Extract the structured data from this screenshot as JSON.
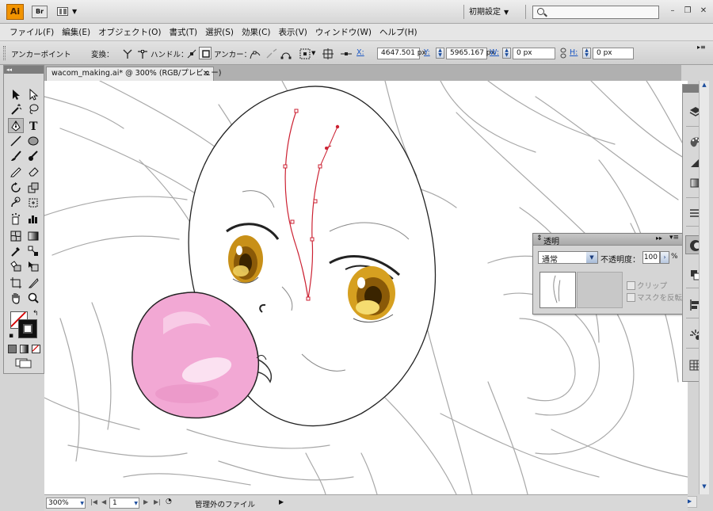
{
  "app": {
    "logo_text": "Ai",
    "bridge_label": "Br"
  },
  "workspace": {
    "label": "初期設定"
  },
  "search": {
    "placeholder": ""
  },
  "menu": [
    "ファイル(F)",
    "編集(E)",
    "オブジェクト(O)",
    "書式(T)",
    "選択(S)",
    "効果(C)",
    "表示(V)",
    "ウィンドウ(W)",
    "ヘルプ(H)"
  ],
  "control": {
    "tool_name": "アンカーポイント",
    "convert_label": "変換：",
    "handle_label": "ハンドル：",
    "anchor_label": "アンカー：",
    "x_label": "X:",
    "x_value": "4647.501 px",
    "y_label": "Y:",
    "y_value": "5965.167 px",
    "w_label": "W:",
    "w_value": "0 px",
    "h_label": "H:",
    "h_value": "0 px"
  },
  "document": {
    "tab_title": "wacom_making.ai* @ 300% (RGB/プレビュー)",
    "close": "×"
  },
  "transparency": {
    "title": "透明",
    "blend_mode": "通常",
    "opacity_label": "不透明度：",
    "opacity_value": "100",
    "opacity_unit": "%",
    "clip_label": "クリップ",
    "invert_mask_label": "マスクを反転"
  },
  "status": {
    "zoom": "300%",
    "page": "1",
    "info": "管理外のファイル"
  },
  "colors": {
    "accent": "#f29400",
    "path_red": "#cc2233",
    "bubble_pink": "#f2a8d4",
    "eye_gold": "#d6a020"
  },
  "icons": [
    "selection-icon",
    "direct-selection-icon",
    "magic-wand-icon",
    "lasso-icon",
    "pen-icon",
    "type-icon",
    "line-icon",
    "ellipse-icon",
    "paintbrush-icon",
    "pencil-icon",
    "blob-brush-icon",
    "eraser-icon",
    "rotate-icon",
    "scale-icon",
    "warp-icon",
    "free-transform-icon",
    "symbol-sprayer-icon",
    "graph-icon",
    "mesh-icon",
    "gradient-icon",
    "eyedropper-icon",
    "blend-icon",
    "live-paint-icon",
    "live-paint-select-icon",
    "artboard-icon",
    "slice-icon",
    "hand-icon",
    "zoom-icon",
    "layers-icon",
    "color-guide-icon",
    "swatches-icon",
    "gradient-panel-icon",
    "stroke-icon",
    "transparency-icon",
    "appearance-icon",
    "align-icon",
    "symbols-icon",
    "brushes-icon"
  ]
}
